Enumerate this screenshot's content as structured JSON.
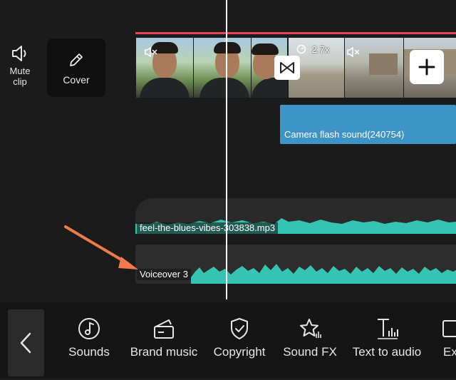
{
  "side_controls": {
    "mute_label": "Mute\nclip",
    "cover_label": "Cover"
  },
  "video_track": {
    "speed_badge": "2.7x"
  },
  "audio_tracks": {
    "sound_effect_clip": "Camera flash sound(240754)",
    "music_clip": "feel-the-blues-vibes-303838.mp3",
    "voiceover_clip": "Voiceover 3"
  },
  "toolbar": {
    "items": [
      {
        "label": "Sounds",
        "icon": "music-note-icon"
      },
      {
        "label": "Brand music",
        "icon": "brand-music-icon"
      },
      {
        "label": "Copyright",
        "icon": "shield-check-icon"
      },
      {
        "label": "Sound FX",
        "icon": "star-sound-icon"
      },
      {
        "label": "Text to audio",
        "icon": "text-audio-icon"
      },
      {
        "label": "Ex",
        "icon": "extract-icon"
      }
    ]
  },
  "colors": {
    "accent_red": "#e8455b",
    "sfx_blue": "#3e93c7",
    "waveform_teal": "#37c3b3",
    "annotation_arrow": "#f07a4b"
  }
}
